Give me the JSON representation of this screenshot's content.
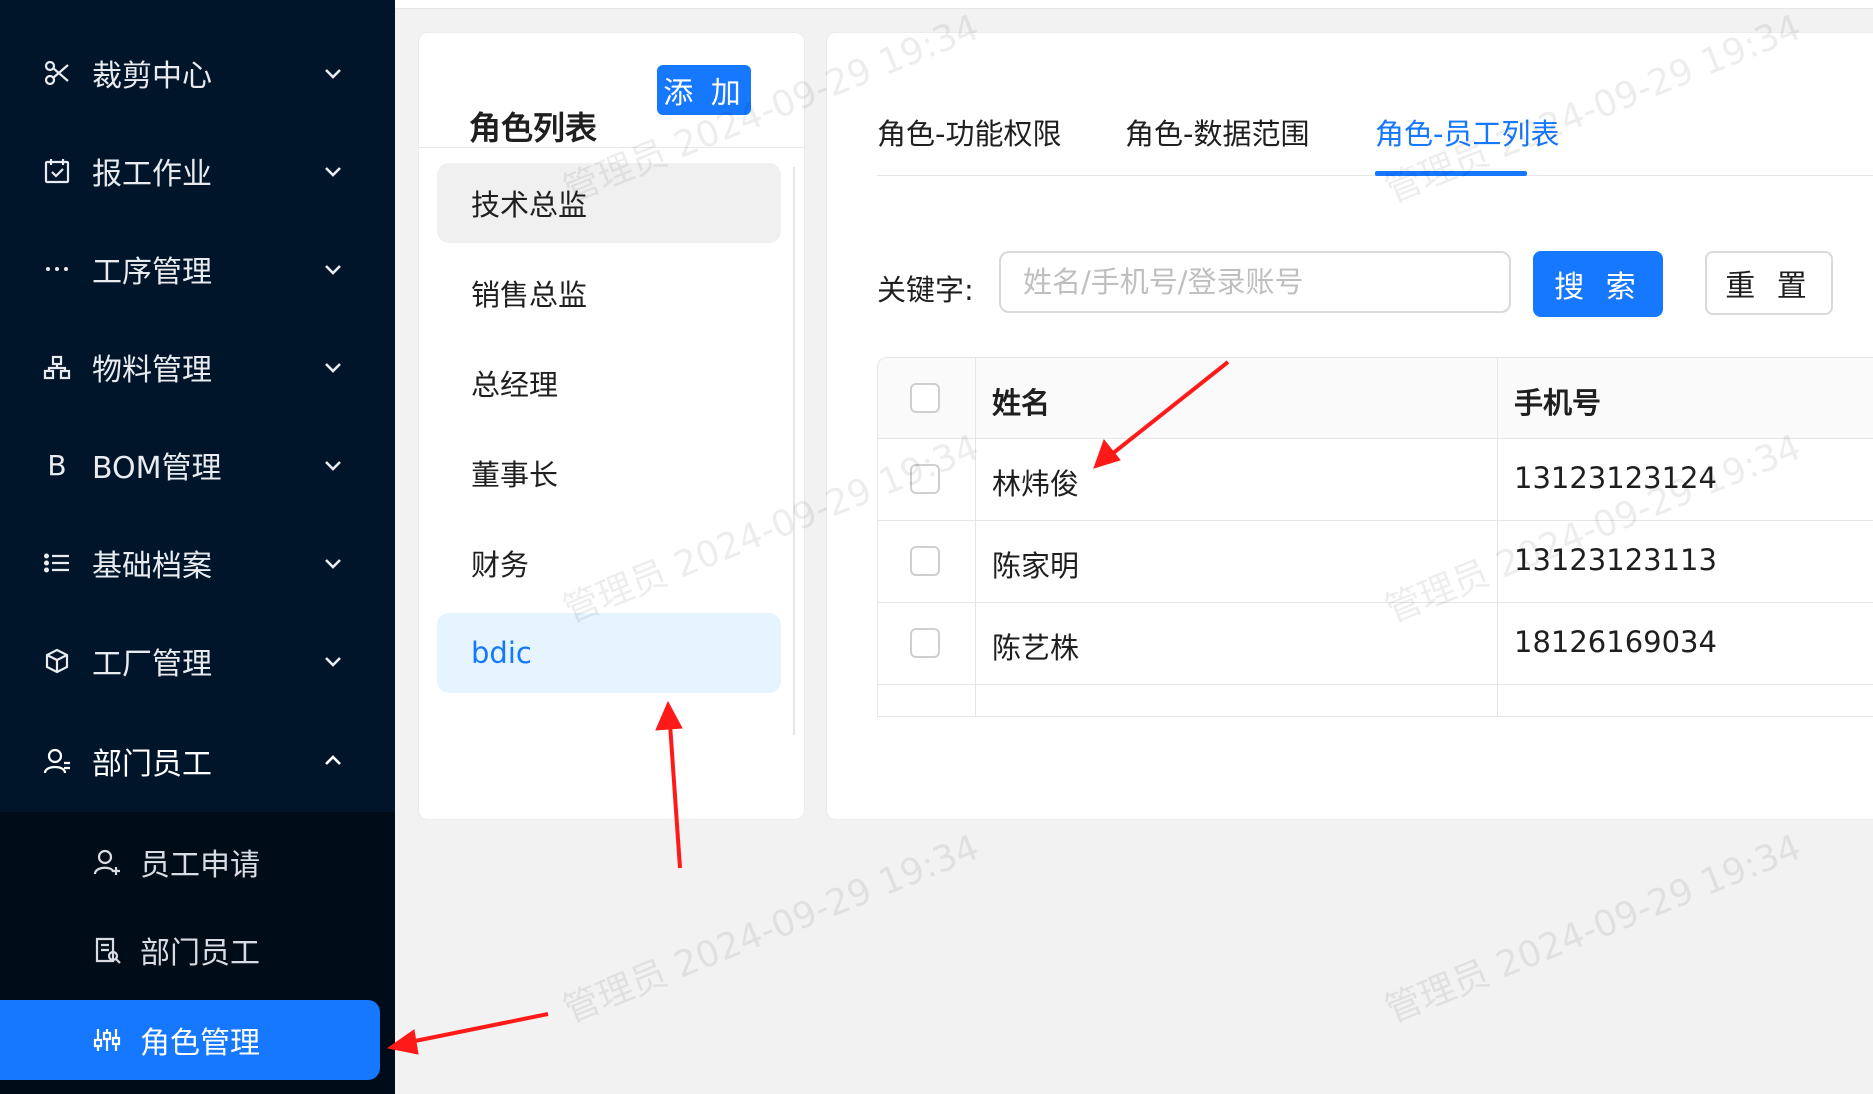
{
  "sidebar": {
    "items": [
      {
        "label": "裁剪中心",
        "icon": "scissors-icon"
      },
      {
        "label": "报工作业",
        "icon": "calendar-check-icon"
      },
      {
        "label": "工序管理",
        "icon": "ellipsis-icon"
      },
      {
        "label": "物料管理",
        "icon": "org-chart-icon"
      },
      {
        "label": "BOM管理",
        "icon": "letter-b-icon"
      },
      {
        "label": "基础档案",
        "icon": "list-icon"
      },
      {
        "label": "工厂管理",
        "icon": "cube-icon"
      },
      {
        "label": "部门员工",
        "icon": "user-icon"
      }
    ],
    "sub_items": [
      {
        "label": "员工申请",
        "icon": "user-add-icon"
      },
      {
        "label": "部门员工",
        "icon": "contact-card-icon"
      },
      {
        "label": "角色管理",
        "icon": "sliders-icon"
      }
    ],
    "active_sub": "角色管理"
  },
  "role_panel": {
    "title": "角色列表",
    "add_label": "添 加",
    "roles": [
      "技术总监",
      "销售总监",
      "总经理",
      "董事长",
      "财务",
      "bdic"
    ],
    "selected": "bdic"
  },
  "tabs": [
    "角色-功能权限",
    "角色-数据范围",
    "角色-员工列表"
  ],
  "active_tab": "角色-员工列表",
  "search": {
    "label": "关键字:",
    "value": "",
    "placeholder": "姓名/手机号/登录账号",
    "search_label": "搜 索",
    "reset_label": "重 置"
  },
  "table": {
    "columns": [
      "姓名",
      "手机号"
    ],
    "rows": [
      {
        "name": "林炜俊",
        "phone": "13123123124"
      },
      {
        "name": "陈家明",
        "phone": "13123123113"
      },
      {
        "name": "陈艺株",
        "phone": "18126169034"
      }
    ]
  },
  "watermark": "管理员 2024-09-29 19:34",
  "colors": {
    "sidebar_bg": "#001529",
    "submenu_bg": "#000c17",
    "primary": "#1677ff",
    "selected_bg": "#e6f4ff",
    "annotation_arrow": "#ff1a1a"
  }
}
